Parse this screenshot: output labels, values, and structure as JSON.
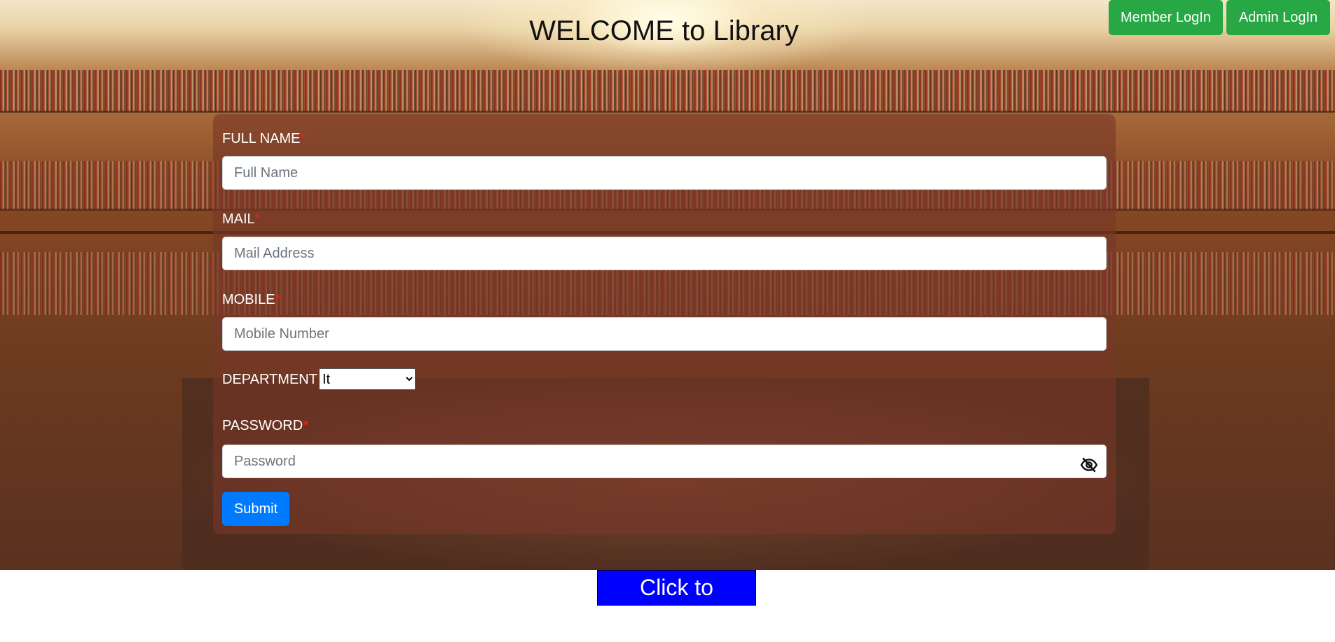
{
  "header": {
    "title": "WELCOME to Library",
    "member_login": "Member LogIn",
    "admin_login": "Admin LogIn"
  },
  "form": {
    "full_name": {
      "label": "FULL NAME",
      "required": "*",
      "placeholder": "Full Name",
      "value": ""
    },
    "mail": {
      "label": "MAIL",
      "required": "*",
      "placeholder": "Mail Address",
      "value": ""
    },
    "mobile": {
      "label": "MOBILE",
      "required": "*",
      "placeholder": "Mobile Number",
      "value": ""
    },
    "department": {
      "label": "DEPARTMENT",
      "selected": "It"
    },
    "password": {
      "label": "PASSWORD",
      "required": "*",
      "placeholder": "Password",
      "value": ""
    },
    "submit_label": "Submit"
  },
  "register_label": "Click to Register",
  "colors": {
    "success_button": "#28a745",
    "primary_button": "#007bff",
    "register_bg": "#0000ff",
    "required_mark": "#e8221b"
  },
  "icons": {
    "password_toggle": "eye-slash-icon"
  }
}
